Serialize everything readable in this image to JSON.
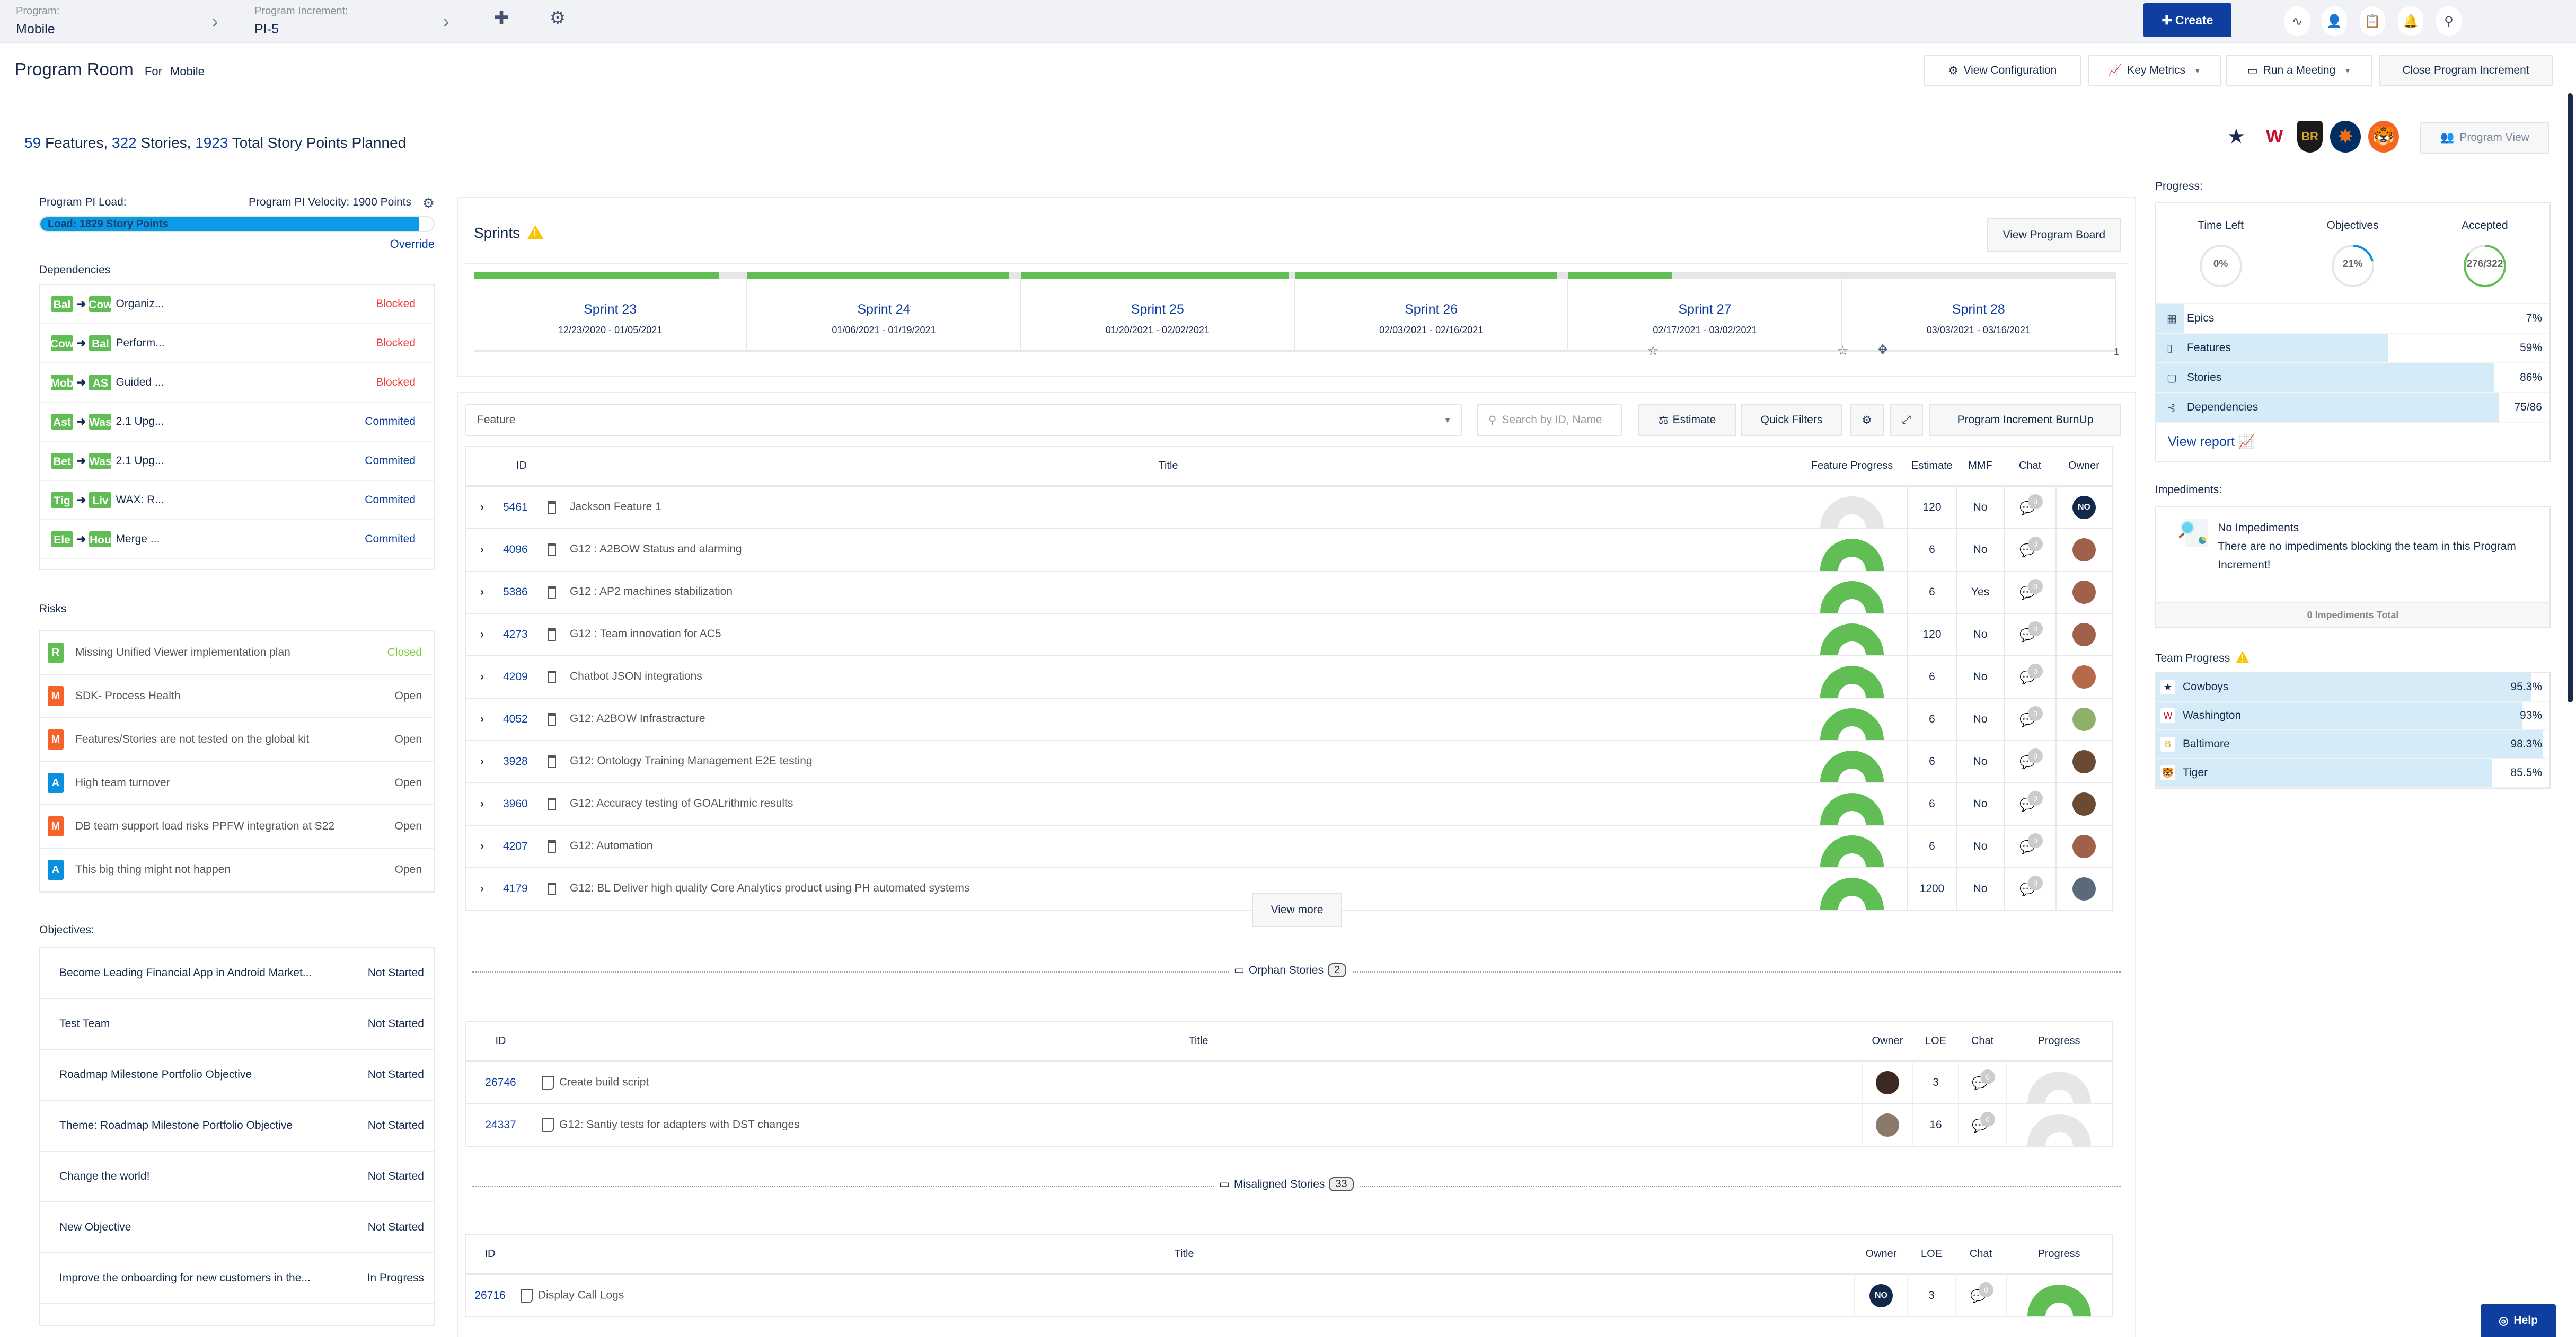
{
  "topbar": {
    "program_label": "Program:",
    "program_value": "Mobile",
    "increment_label": "Program Increment:",
    "increment_value": "PI-5",
    "create_label": "Create"
  },
  "header": {
    "title": "Program Room",
    "for_label": "For",
    "for_value": "Mobile",
    "buttons": {
      "view_configuration": "View Configuration",
      "key_metrics": "Key Metrics",
      "run_meeting": "Run a Meeting",
      "close_pi": "Close Program Increment"
    },
    "program_view": "Program View"
  },
  "summary": {
    "features_count": "59",
    "features_label": "Features,",
    "stories_count": "322",
    "stories_label": "Stories,",
    "points_count": "1923",
    "points_label": "Total Story Points Planned"
  },
  "teams_logos": [
    "Cowboys",
    "Washington",
    "Baltimore",
    "Houston",
    "Tiger"
  ],
  "load": {
    "label": "Program PI Load:",
    "velocity": "Program PI Velocity: 1900 Points",
    "bar_text": "Load: 1829 Story Points",
    "load_points": 1829,
    "velocity_points": 1900,
    "override": "Override"
  },
  "dependencies": {
    "title": "Dependencies",
    "items": [
      {
        "from": "Bal",
        "to": "Cow",
        "title": "Organiz...",
        "status": "Blocked"
      },
      {
        "from": "Cow",
        "to": "Bal",
        "title": "Perform...",
        "status": "Blocked"
      },
      {
        "from": "Mob",
        "to": "AS",
        "title": "Guided ...",
        "status": "Blocked"
      },
      {
        "from": "Ast",
        "to": "Was",
        "title": "2.1 Upg...",
        "status": "Commited"
      },
      {
        "from": "Bet",
        "to": "Was",
        "title": "2.1 Upg...",
        "status": "Commited"
      },
      {
        "from": "Tig",
        "to": "Liv",
        "title": "WAX: R...",
        "status": "Commited"
      },
      {
        "from": "Ele",
        "to": "Hou",
        "title": "Merge ...",
        "status": "Commited"
      }
    ]
  },
  "risks": {
    "title": "Risks",
    "items": [
      {
        "badge": "R",
        "color": "#61be55",
        "title": "Missing Unified Viewer implementation plan",
        "status": "Closed"
      },
      {
        "badge": "M",
        "color": "#f4632a",
        "title": "SDK- Process Health",
        "status": "Open"
      },
      {
        "badge": "M",
        "color": "#f4632a",
        "title": "Features/Stories are not tested on the global kit",
        "status": "Open"
      },
      {
        "badge": "A",
        "color": "#0b8fdf",
        "title": "High team turnover",
        "status": "Open"
      },
      {
        "badge": "M",
        "color": "#f4632a",
        "title": "DB team support load risks PPFW integration at S22",
        "status": "Open"
      },
      {
        "badge": "A",
        "color": "#0b8fdf",
        "title": "This big thing might not happen",
        "status": "Open"
      }
    ]
  },
  "objectives": {
    "title": "Objectives:",
    "items": [
      {
        "title": "Become Leading Financial App in Android Market...",
        "status": "Not Started"
      },
      {
        "title": "Test Team",
        "status": "Not Started"
      },
      {
        "title": "Roadmap Milestone Portfolio Objective",
        "status": "Not Started"
      },
      {
        "title": "Theme: Roadmap Milestone Portfolio Objective",
        "status": "Not Started"
      },
      {
        "title": "Change the world!",
        "status": "Not Started"
      },
      {
        "title": "New Objective",
        "status": "Not Started"
      },
      {
        "title": "Improve the onboarding for new customers in the...",
        "status": "In Progress"
      }
    ]
  },
  "sprints": {
    "title": "Sprints",
    "view_board": "View Program Board",
    "items": [
      {
        "name": "Sprint 23",
        "dates": "12/23/2020 - 01/05/2021",
        "progress": 0.9
      },
      {
        "name": "Sprint 24",
        "dates": "01/06/2021 - 01/19/2021",
        "progress": 0.96
      },
      {
        "name": "Sprint 25",
        "dates": "01/20/2021 - 02/02/2021",
        "progress": 0.98
      },
      {
        "name": "Sprint 26",
        "dates": "02/03/2021 - 02/16/2021",
        "progress": 0.96
      },
      {
        "name": "Sprint 27",
        "dates": "02/17/2021 - 03/02/2021",
        "progress": 0.38
      },
      {
        "name": "Sprint 28",
        "dates": "03/03/2021 - 03/16/2021",
        "progress": 0
      }
    ],
    "end_marker": "1"
  },
  "features": {
    "select_value": "Feature",
    "search_placeholder": "Search by ID, Name",
    "estimate_btn": "Estimate",
    "quick_filters_btn": "Quick Filters",
    "burnup_btn": "Program Increment BurnUp",
    "columns": [
      "ID",
      "Title",
      "Feature Progress",
      "Estimate",
      "MMF",
      "Chat",
      "Owner"
    ],
    "rows": [
      {
        "id": "5461",
        "title": "Jackson Feature 1",
        "estimate": "120",
        "mmf": "No",
        "chat": "0",
        "owner": "NO",
        "done": false
      },
      {
        "id": "4096",
        "title": "G12 : A2BOW Status and alarming",
        "estimate": "6",
        "mmf": "No",
        "chat": "0",
        "owner": "",
        "done": true
      },
      {
        "id": "5386",
        "title": "G12 : AP2 machines stabilization",
        "estimate": "6",
        "mmf": "Yes",
        "chat": "0",
        "owner": "",
        "done": true
      },
      {
        "id": "4273",
        "title": "G12 : Team innovation for AC5",
        "estimate": "120",
        "mmf": "No",
        "chat": "0",
        "owner": "",
        "done": true
      },
      {
        "id": "4209",
        "title": "Chatbot JSON integrations",
        "estimate": "6",
        "mmf": "No",
        "chat": "0",
        "owner": "",
        "done": true
      },
      {
        "id": "4052",
        "title": "G12: A2BOW Infrastracture",
        "estimate": "6",
        "mmf": "No",
        "chat": "0",
        "owner": "",
        "done": true
      },
      {
        "id": "3928",
        "title": "G12: Ontology Training Management E2E testing",
        "estimate": "6",
        "mmf": "No",
        "chat": "0",
        "owner": "",
        "done": true
      },
      {
        "id": "3960",
        "title": "G12: Accuracy testing of GOALrithmic results",
        "estimate": "6",
        "mmf": "No",
        "chat": "0",
        "owner": "",
        "done": true
      },
      {
        "id": "4207",
        "title": "G12: Automation",
        "estimate": "6",
        "mmf": "No",
        "chat": "0",
        "owner": "",
        "done": true
      },
      {
        "id": "4179",
        "title": "G12: BL Deliver high quality Core Analytics product using PH automated systems",
        "estimate": "1200",
        "mmf": "No",
        "chat": "0",
        "owner": "",
        "done": true
      }
    ],
    "view_more": "View more"
  },
  "orphan": {
    "label": "Orphan Stories",
    "count": "2",
    "columns": [
      "ID",
      "Title",
      "Owner",
      "LOE",
      "Chat",
      "Progress"
    ],
    "rows": [
      {
        "id": "26746",
        "title": "Create build script",
        "loe": "3",
        "chat": "0"
      },
      {
        "id": "24337",
        "title": "G12: Santiy tests for adapters with DST changes",
        "loe": "16",
        "chat": "0"
      }
    ]
  },
  "misaligned": {
    "label": "Misaligned Stories",
    "count": "33",
    "columns": [
      "ID",
      "Title",
      "Owner",
      "LOE",
      "Chat",
      "Progress"
    ],
    "rows": [
      {
        "id": "26716",
        "title": "Display Call Logs",
        "owner": "NO",
        "loe": "3",
        "chat": "0"
      }
    ]
  },
  "progress": {
    "title": "Progress:",
    "time_left": {
      "label": "Time Left",
      "value": "0%",
      "fraction": 0
    },
    "objectives": {
      "label": "Objectives",
      "value": "21%",
      "fraction": 0.21
    },
    "accepted": {
      "label": "Accepted",
      "value": "276/322",
      "fraction": 0.857
    },
    "bars": [
      {
        "name": "Epics",
        "value": "7%",
        "fraction": 0.07
      },
      {
        "name": "Features",
        "value": "59%",
        "fraction": 0.59
      },
      {
        "name": "Stories",
        "value": "86%",
        "fraction": 0.86
      },
      {
        "name": "Dependencies",
        "value": "75/86",
        "fraction": 0.872
      }
    ],
    "view_report": "View report"
  },
  "impediments": {
    "title": "Impediments:",
    "heading": "No Impediments",
    "message": "There are no impediments blocking the team in this Program Increment!",
    "total": "0 Impediments Total"
  },
  "team_progress": {
    "title": "Team Progress",
    "items": [
      {
        "name": "Cowboys",
        "value": "95.3%",
        "fraction": 0.953
      },
      {
        "name": "Washington",
        "value": "93%",
        "fraction": 0.93
      },
      {
        "name": "Baltimore",
        "value": "98.3%",
        "fraction": 0.983
      },
      {
        "name": "Tiger",
        "value": "85.5%",
        "fraction": 0.855
      }
    ]
  },
  "help": {
    "label": "Help"
  },
  "colors": {
    "brand": "#0e3fa0",
    "green": "#61be55",
    "blocked": "#ee3b3b",
    "load_bar": "#0a9be6",
    "progress_fill": "#d6ebf8"
  }
}
